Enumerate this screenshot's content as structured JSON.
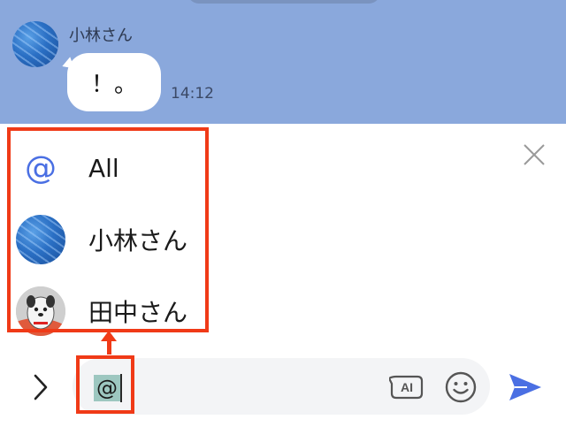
{
  "chat": {
    "sender_name": "小林さん",
    "message_text": "！。",
    "message_time": "14:12"
  },
  "mention_list": {
    "items": [
      {
        "label": "All",
        "icon": "at-icon"
      },
      {
        "label": "小林さん",
        "icon": "avatar"
      },
      {
        "label": "田中さん",
        "icon": "avatar"
      }
    ]
  },
  "input": {
    "typed_text": "@"
  },
  "icons": {
    "close": "close-icon",
    "expand": "chevron-right-icon",
    "ai": "ai-icon",
    "emoji": "emoji-icon",
    "send": "send-icon"
  },
  "colors": {
    "chat_background": "#8aa8dc",
    "accent": "#4a6fe3",
    "annotation": "#f03a17",
    "send": "#4a6fe3"
  }
}
